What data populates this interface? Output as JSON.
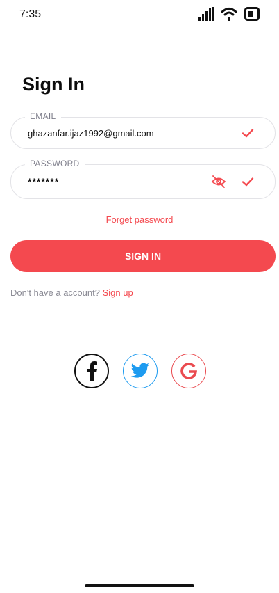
{
  "status_bar": {
    "time": "7:35",
    "icons": [
      "cellular-signal-icon",
      "wifi-icon",
      "battery-icon"
    ]
  },
  "page": {
    "title": "Sign In"
  },
  "email_field": {
    "label": "EMAIL",
    "value": "ghazanfar.ijaz1992@gmail.com",
    "status_icon": "check-icon"
  },
  "password_field": {
    "label": "PASSWORD",
    "value": "*******",
    "toggle_icon": "eye-slash-icon",
    "status_icon": "check-icon"
  },
  "forget_password": "Forget password",
  "signin_button": "SIGN IN",
  "account_prompt": {
    "text": "Don't have a account?",
    "link": "Sign up"
  },
  "social_buttons": [
    "facebook-icon",
    "twitter-icon",
    "google-icon"
  ],
  "colors": {
    "accent": "#f4494f",
    "twitter": "#1d9bf0",
    "border": "#e3e3e7",
    "label": "#7d7d8a"
  }
}
